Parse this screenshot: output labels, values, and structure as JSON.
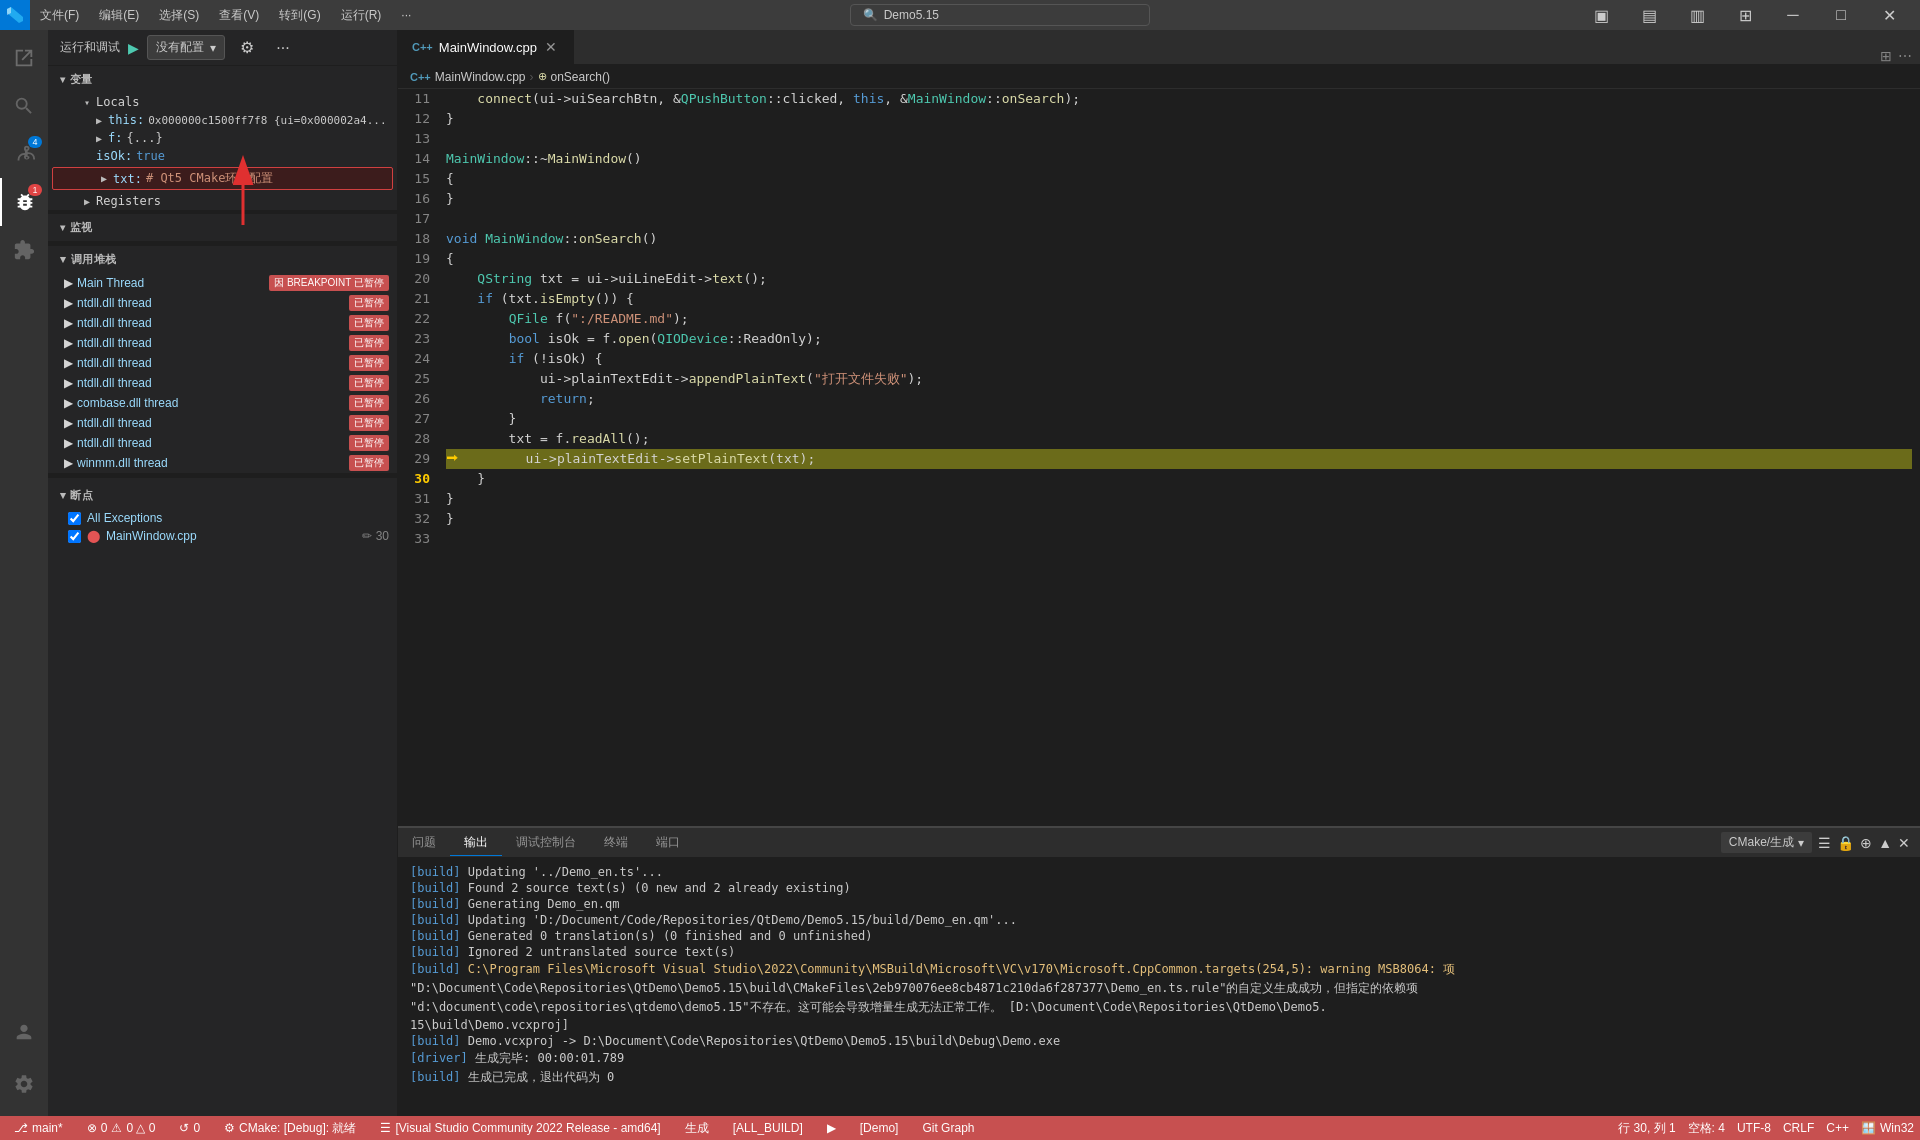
{
  "titlebar": {
    "logo": "⬛",
    "menus": [
      "文件(F)",
      "编辑(E)",
      "选择(S)",
      "查看(V)",
      "转到(G)",
      "运行(R)",
      "···"
    ],
    "search_placeholder": "Demo5.15",
    "window_controls": [
      "─",
      "□",
      "✕"
    ]
  },
  "activity": {
    "items": [
      {
        "id": "explorer",
        "icon": "📄",
        "active": false
      },
      {
        "id": "search",
        "icon": "🔍",
        "active": false
      },
      {
        "id": "source-control",
        "icon": "⑂",
        "active": false,
        "badge": "4"
      },
      {
        "id": "debug",
        "icon": "▶",
        "active": true,
        "badge": "1"
      },
      {
        "id": "extensions",
        "icon": "⊞",
        "active": false
      }
    ],
    "bottom_items": [
      {
        "id": "account",
        "icon": "👤"
      },
      {
        "id": "settings",
        "icon": "⚙"
      }
    ]
  },
  "debug_toolbar": {
    "label": "运行和调试",
    "play_icon": "▶",
    "config_label": "没有配置",
    "gear_icon": "⚙",
    "more_icon": "···",
    "controls": [
      "⏸",
      "⟳",
      "⬇",
      "⬆",
      "⬅",
      "⏺",
      "⏹"
    ]
  },
  "sidebar": {
    "variables_header": "变量",
    "locals_header": "Locals",
    "locals_expanded": true,
    "vars": [
      {
        "indent": 2,
        "arrow": "▶",
        "name": "this:",
        "value": "0x000000c1500ff7f8 {ui=0x000002a4..."
      },
      {
        "indent": 2,
        "arrow": "▶",
        "name": "f:",
        "value": "{...}"
      },
      {
        "indent": 2,
        "name": "isOk:",
        "value": "true",
        "type": "bool"
      },
      {
        "indent": 2,
        "arrow": "▶",
        "name": "txt:",
        "value": "# Qt5 CMake环境配置",
        "highlighted": true
      }
    ],
    "registers_header": "Registers",
    "watch_header": "监视",
    "callstack": {
      "header": "调用堆栈",
      "threads": [
        {
          "name": "Main Thread",
          "badge": "因 BREAKPOINT 已暂停"
        },
        {
          "name": "ntdll.dll thread",
          "badge": "已暂停"
        },
        {
          "name": "ntdll.dll thread",
          "badge": "已暂停"
        },
        {
          "name": "ntdll.dll thread",
          "badge": "已暂停"
        },
        {
          "name": "ntdll.dll thread",
          "badge": "已暂停"
        },
        {
          "name": "ntdll.dll thread",
          "badge": "已暂停"
        },
        {
          "name": "combase.dll thread",
          "badge": "已暂停"
        },
        {
          "name": "ntdll.dll thread",
          "badge": "已暂停"
        },
        {
          "name": "ntdll.dll thread",
          "badge": "已暂停"
        },
        {
          "name": "winmm.dll thread",
          "badge": "已暂停"
        }
      ]
    },
    "breakpoints": {
      "header": "断点",
      "items": [
        {
          "checked": true,
          "name": "All Exceptions"
        },
        {
          "checked": true,
          "name": "MainWindow.cpp",
          "line": "30",
          "icons": "✏ 30"
        }
      ]
    }
  },
  "editor": {
    "tabs": [
      {
        "label": "MainWindow.cpp",
        "active": true,
        "modified": false,
        "icon": "C++"
      }
    ],
    "breadcrumbs": [
      "MainWindow.cpp",
      "onSearch()"
    ],
    "lines": [
      {
        "num": 11,
        "content": "    connect(ui->uiSearchBtn, &QPushButton::clicked, this, &MainWindow::onSearch);"
      },
      {
        "num": 12,
        "tokens": [
          {
            "text": "        connect(ui->uiSearchBtn, &",
            "cls": ""
          },
          {
            "text": "QPushButton",
            "cls": "cn"
          },
          {
            "text": "::clicked, this, &",
            "cls": ""
          },
          {
            "text": "MainWindow",
            "cls": "cn"
          },
          {
            "text": "::onSearch);",
            "cls": ""
          }
        ]
      },
      {
        "num": 13,
        "content": "    }"
      },
      {
        "num": 14,
        "content": ""
      },
      {
        "num": 15,
        "content": "MainWindow::~MainWindow()",
        "tokens": [
          {
            "text": "MainWindow",
            "cls": "cn"
          },
          {
            "text": "::",
            "cls": ""
          },
          {
            "text": "~MainWindow",
            "cls": "fn"
          },
          {
            "text": "()",
            "cls": ""
          }
        ]
      },
      {
        "num": 16,
        "content": "    {"
      },
      {
        "num": 17,
        "content": "    }"
      },
      {
        "num": 18,
        "content": ""
      },
      {
        "num": 19,
        "content": "void MainWindow::onSearch()",
        "tokens": [
          {
            "text": "void",
            "cls": "kw"
          },
          {
            "text": " MainWindow::",
            "cls": ""
          },
          {
            "text": "onSearch",
            "cls": "fn"
          },
          {
            "text": "()",
            "cls": ""
          }
        ]
      },
      {
        "num": 20,
        "content": "    {"
      },
      {
        "num": 21,
        "content": "        QString txt = ui->uiLineEdit->text();",
        "tokens": [
          {
            "text": "        ",
            "cls": ""
          },
          {
            "text": "QString",
            "cls": "cn"
          },
          {
            "text": " txt = ui->uiLineEdit->",
            "cls": ""
          },
          {
            "text": "text",
            "cls": "fn"
          },
          {
            "text": "();",
            "cls": ""
          }
        ]
      },
      {
        "num": 22,
        "content": "        if (txt.isEmpty()) {",
        "tokens": [
          {
            "text": "        ",
            "cls": ""
          },
          {
            "text": "if",
            "cls": "kw"
          },
          {
            "text": " (txt.",
            "cls": ""
          },
          {
            "text": "isEmpty",
            "cls": "fn"
          },
          {
            "text": "()) {",
            "cls": ""
          }
        ]
      },
      {
        "num": 23,
        "content": "            QFile f(\":/README.md\");",
        "tokens": [
          {
            "text": "            ",
            "cls": ""
          },
          {
            "text": "QFile",
            "cls": "cn"
          },
          {
            "text": " f(",
            "cls": ""
          },
          {
            "text": "\":/README.md\"",
            "cls": "str"
          },
          {
            "text": ");",
            "cls": ""
          }
        ]
      },
      {
        "num": 24,
        "content": "            bool isOk = f.open(QIODevice::ReadOnly);",
        "tokens": [
          {
            "text": "            ",
            "cls": ""
          },
          {
            "text": "bool",
            "cls": "kw"
          },
          {
            "text": " isOk = f.",
            "cls": ""
          },
          {
            "text": "open",
            "cls": "fn"
          },
          {
            "text": "(",
            "cls": ""
          },
          {
            "text": "QIODevice",
            "cls": "cn"
          },
          {
            "text": "::ReadOnly);",
            "cls": ""
          }
        ]
      },
      {
        "num": 25,
        "content": "            if (!isOk) {",
        "tokens": [
          {
            "text": "            ",
            "cls": ""
          },
          {
            "text": "if",
            "cls": "kw"
          },
          {
            "text": " (!isOk) {",
            "cls": ""
          }
        ]
      },
      {
        "num": 26,
        "content": "                ui->plainTextEdit->appendPlainText(\"打开文件失败\");",
        "tokens": [
          {
            "text": "                ui->plainTextEdit->",
            "cls": ""
          },
          {
            "text": "appendPlainText",
            "cls": "fn"
          },
          {
            "text": "(",
            "cls": ""
          },
          {
            "text": "\"打开文件失败\"",
            "cls": "str"
          },
          {
            "text": ");",
            "cls": ""
          }
        ]
      },
      {
        "num": 27,
        "content": "                return;",
        "tokens": [
          {
            "text": "                ",
            "cls": ""
          },
          {
            "text": "return",
            "cls": "kw"
          },
          {
            "text": ";",
            "cls": ""
          }
        ]
      },
      {
        "num": 28,
        "content": "            }"
      },
      {
        "num": 29,
        "content": "            txt = f.readAll();",
        "tokens": [
          {
            "text": "            txt = f.",
            "cls": ""
          },
          {
            "text": "readAll",
            "cls": "fn"
          },
          {
            "text": "();",
            "cls": ""
          }
        ]
      },
      {
        "num": 30,
        "content": "            ui->plainTextEdit->setPlainText(txt);",
        "active": true,
        "debug": true,
        "tokens": [
          {
            "text": "            ui->plainTextEdit->",
            "cls": ""
          },
          {
            "text": "setPlainText",
            "cls": "fn"
          },
          {
            "text": "(txt);",
            "cls": ""
          }
        ]
      },
      {
        "num": 31,
        "content": "        }"
      },
      {
        "num": 32,
        "content": "    }"
      },
      {
        "num": 33,
        "content": "    }"
      }
    ]
  },
  "panel": {
    "tabs": [
      "问题",
      "输出",
      "调试控制台",
      "终端",
      "端口"
    ],
    "active_tab": "输出",
    "toolbar_label": "CMake/生成",
    "output_lines": [
      "[build]   Updating '../Demo_en.ts'...",
      "[build]       Found 2 source text(s) (0 new and 2 already existing)",
      "[build]   Generating Demo_en.qm",
      "[build]   Updating 'D:/Document/Code/Repositories/QtDemo/Demo5.15/build/Demo_en.qm'...",
      "[build]       Generated 0 translation(s) (0 finished and 0 unfinished)",
      "[build]   Ignored 2 untranslated source text(s)",
      "[build] C:\\Program Files\\Microsoft Visual Studio\\2022\\Community\\MSBuild\\Microsoft\\VC\\v170\\Microsoft.CppCommon.targets(254,5): warning MSB8064: 项",
      "\"D:\\Document\\Code\\Repositories\\QtDemo\\Demo5.15\\build\\CMakeFiles\\2eb970076ee8cb4871c210da6f287377\\Demo_en.ts.rule\"的自定义生成成功，但指定的依赖项",
      "\"d:\\document\\code\\repositories\\qtdemo\\demo5.15\"不存在。这可能会导致增量生成无法正常工作。 [D:\\Document\\Code\\Repositories\\QtDemo\\Demo5.",
      "15\\build\\Demo.vcxproj]",
      "[build]   Demo.vcxproj -> D:\\Document\\Code\\Repositories\\QtDemo\\Demo5.15\\build\\Debug\\Demo.exe",
      "[driver] 生成完毕: 00:00:01.789",
      "[build] 生成已完成，退出代码为 0"
    ]
  },
  "statusbar": {
    "left_items": [
      {
        "icon": "⎇",
        "label": "main*"
      },
      {
        "icon": "⊗",
        "label": "0"
      },
      {
        "icon": "⚠",
        "label": "0 △ 0"
      },
      {
        "icon": "↺",
        "label": "0"
      },
      {
        "icon": "⚙",
        "label": "CMake: [Debug]: 就绪"
      },
      {
        "icon": "☰",
        "label": "[Visual Studio Community 2022 Release - amd64]"
      },
      {
        "icon": "",
        "label": "生成"
      },
      {
        "icon": "",
        "label": "[ALL_BUILD]"
      },
      {
        "icon": "▶",
        "label": ""
      },
      {
        "icon": "",
        "label": "[Demo]"
      },
      {
        "icon": "",
        "label": "Git Graph"
      }
    ],
    "right_items": [
      {
        "label": "行 30, 列 1"
      },
      {
        "label": "空格: 4"
      },
      {
        "label": "UTF-8"
      },
      {
        "label": "CRLF"
      },
      {
        "label": "C++"
      },
      {
        "label": "Win32"
      }
    ]
  }
}
